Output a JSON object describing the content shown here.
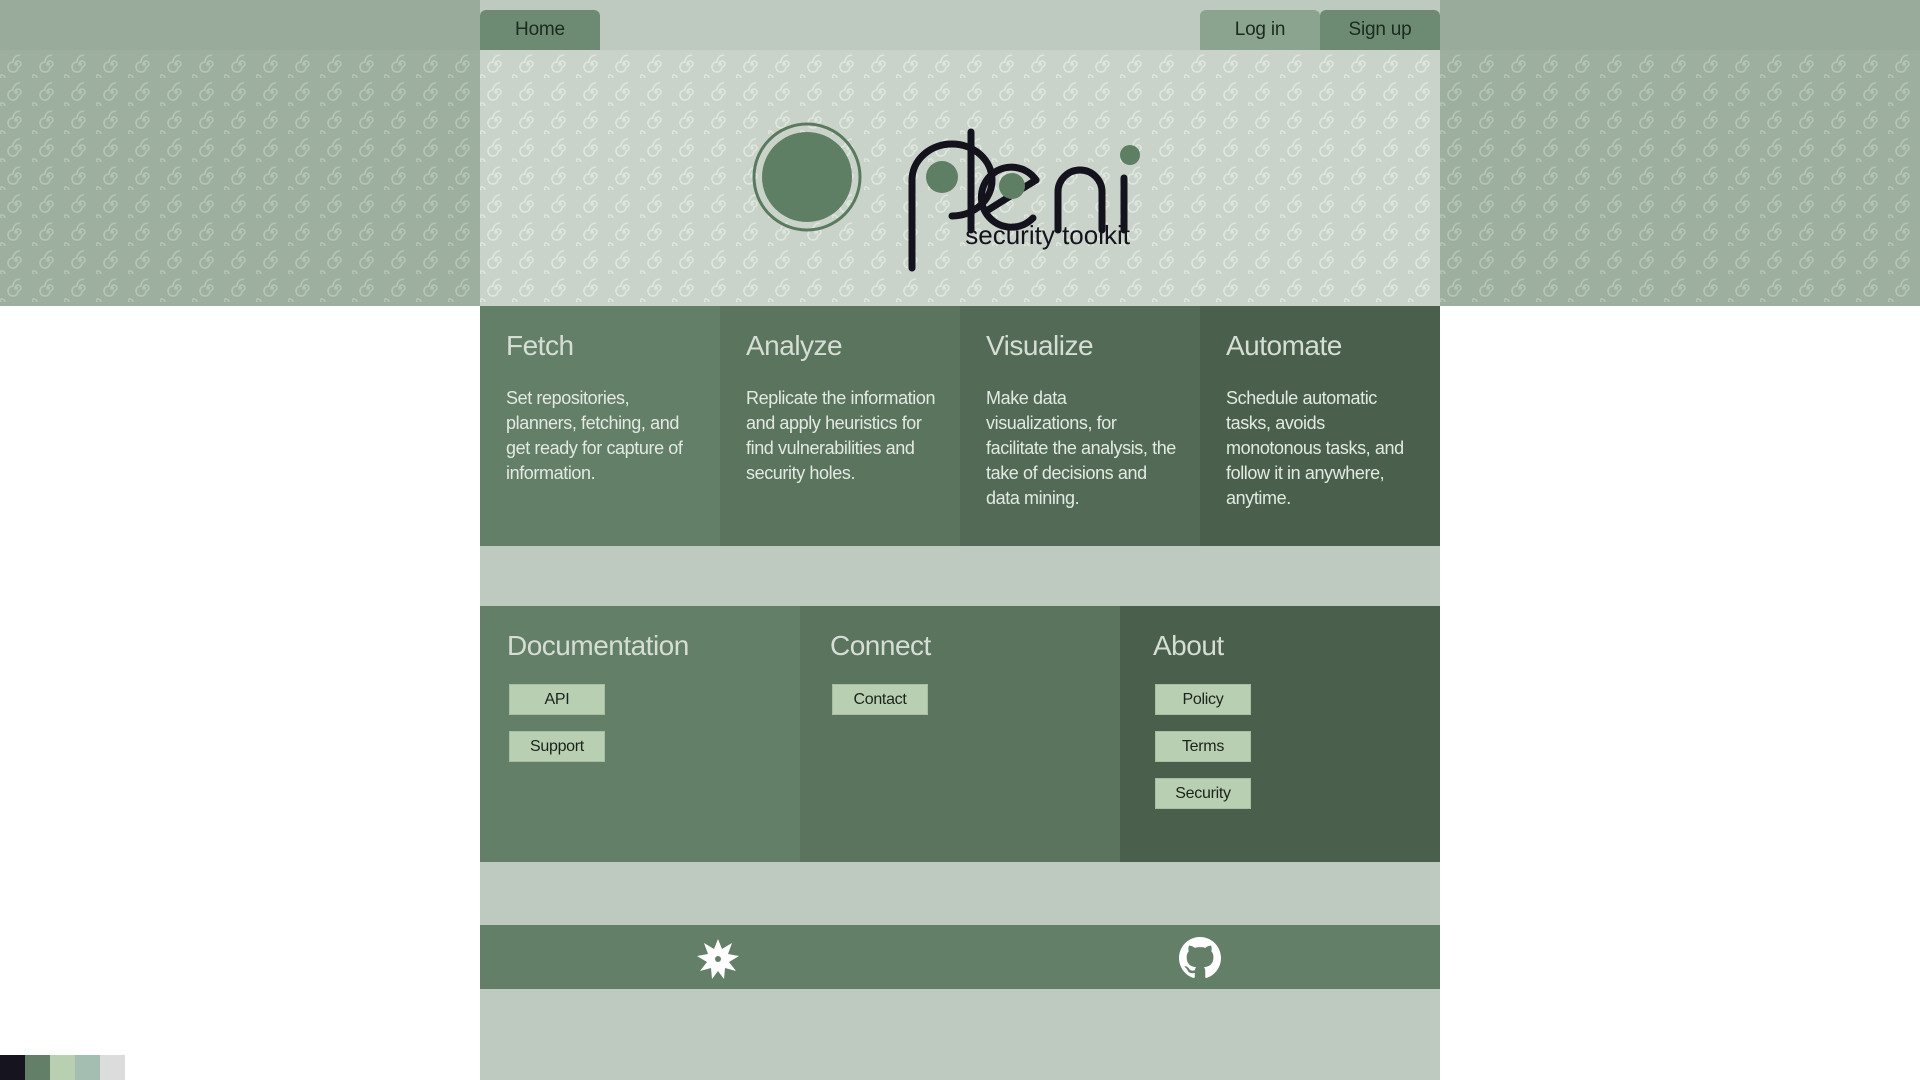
{
  "nav": {
    "home_label": "Home",
    "login_label": "Log in",
    "signup_label": "Sign up"
  },
  "hero": {
    "logo_wordmark": "pleni",
    "tagline": "security toolkit"
  },
  "features": [
    {
      "title": "Fetch",
      "text": "Set repositories, planners, fetching, and get ready for capture of information."
    },
    {
      "title": "Analyze",
      "text": "Replicate the information and apply heuristics for find vulnerabilities and security holes."
    },
    {
      "title": "Visualize",
      "text": "Make data visualizations, for facilitate the analysis, the take of decisions and data mining."
    },
    {
      "title": "Automate",
      "text": "Schedule automatic tasks, avoids monotonous tasks, and follow it in anywhere, anytime."
    }
  ],
  "links": {
    "documentation": {
      "title": "Documentation",
      "buttons": [
        "API",
        "Support"
      ]
    },
    "connect": {
      "title": "Connect",
      "buttons": [
        "Contact"
      ]
    },
    "about": {
      "title": "About",
      "buttons": [
        "Policy",
        "Terms",
        "Security"
      ]
    }
  },
  "footer": {
    "left_icon": "star-badge-icon",
    "right_icon": "github-icon"
  },
  "palette": [
    "#16141f",
    "#647f68",
    "#b9cfb2",
    "#a4bfb1",
    "#dcdcdc"
  ]
}
